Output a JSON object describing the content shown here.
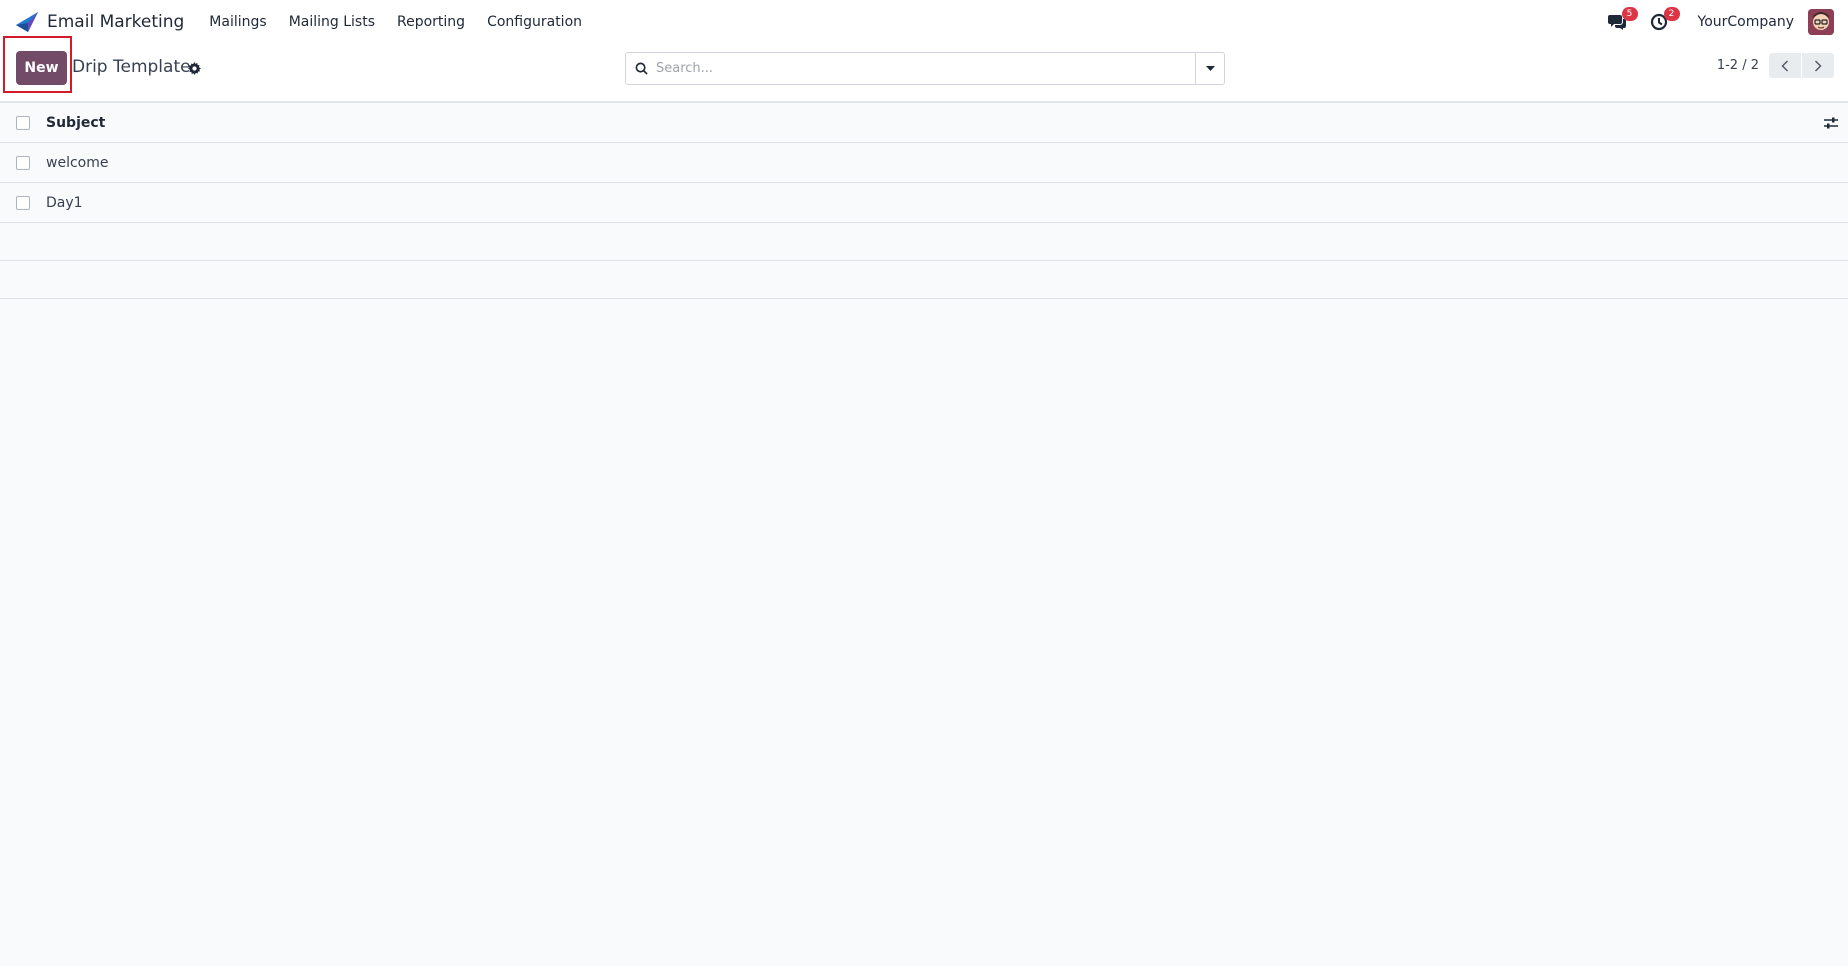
{
  "navbar": {
    "app_name": "Email Marketing",
    "menu": [
      "Mailings",
      "Mailing Lists",
      "Reporting",
      "Configuration"
    ],
    "messages_count": "5",
    "activities_count": "2",
    "company": "YourCompany"
  },
  "control_panel": {
    "new_label": "New",
    "title": "Drip Template",
    "search_placeholder": "Search...",
    "pager": "1-2 / 2"
  },
  "list": {
    "columns": [
      "Subject"
    ],
    "rows": [
      {
        "subject": "welcome"
      },
      {
        "subject": "Day1"
      }
    ]
  },
  "colors": {
    "brand_primary": "#714b67",
    "badge": "#dc3545",
    "highlight": "#d11a2a"
  }
}
